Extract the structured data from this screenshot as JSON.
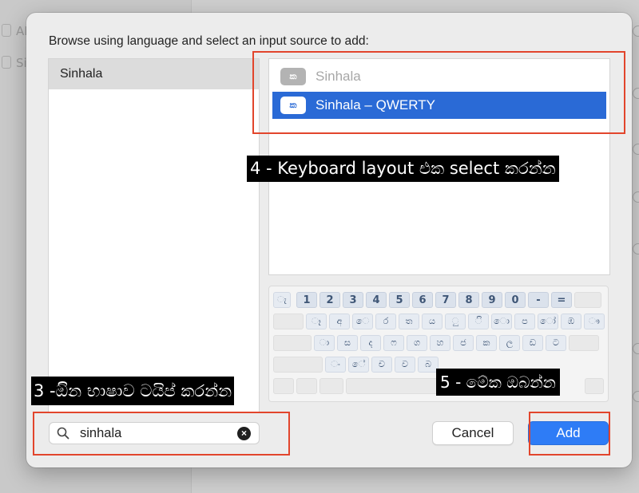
{
  "background": {
    "sidebar_rows": [
      "AB",
      "Si"
    ]
  },
  "sheet": {
    "instruction": "Browse using language and select an input source to add:",
    "languages": [
      {
        "label": "Sinhala",
        "selected": true
      }
    ],
    "input_sources": [
      {
        "icon_text": "ක",
        "label": "Sinhala",
        "state": "disabled"
      },
      {
        "icon_text": "ක",
        "label": "Sinhala – QWERTY",
        "state": "selected"
      }
    ],
    "keyboard": {
      "number_row": [
        "ැ",
        "1",
        "2",
        "3",
        "4",
        "5",
        "6",
        "7",
        "8",
        "9",
        "0",
        "-",
        "="
      ],
      "row1": [
        "ෑ",
        "අ",
        "ෙ",
        "ර",
        "ත",
        "ය",
        "ු",
        "ි",
        "ො",
        "ප",
        "ෝ",
        "ඹ",
        "ෟ"
      ],
      "row2": [
        "ා",
        "ස",
        "ද",
        "ෆ",
        "ග",
        "හ",
        "ජ",
        "ක",
        "ල",
        "ඩ",
        "ට"
      ],
      "row3": [
        "ං",
        "ේ",
        "ච",
        "ව",
        "බ"
      ]
    },
    "search": {
      "value": "sinhala"
    },
    "buttons": {
      "cancel": "Cancel",
      "add": "Add"
    },
    "selected_color": "#2a6ad6",
    "accent_color": "#2e7cf6"
  },
  "annotations": {
    "step3": "3 -ඔින භාෂාව ටයිප් කරන්න",
    "step4": "4 - Keyboard layout එක select කරන්න",
    "step5": "5 - මේක ඔබන්න",
    "highlight_color": "#e2452c"
  }
}
